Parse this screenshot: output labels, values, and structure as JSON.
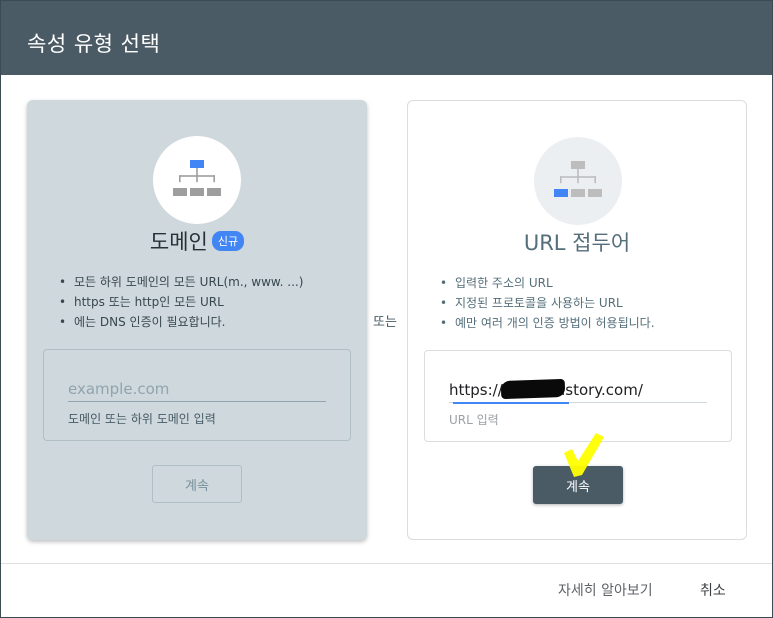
{
  "dialog": {
    "title": "속성 유형 선택"
  },
  "domain_card": {
    "title": "도메인",
    "badge": "신규",
    "bullets": [
      "모든 하위 도메인의 모든 URL(m., www. ...)",
      "https 또는 http인 모든 URL",
      "에는 DNS 인증이 필요합니다."
    ],
    "input": {
      "value": "",
      "placeholder": "example.com",
      "help": "도메인 또는 하위 도메인 입력"
    },
    "continue_label": "계속",
    "icon": "sitemap-icon"
  },
  "separator": {
    "label": "또는"
  },
  "url_card": {
    "title": "URL 접두어",
    "bullets": [
      "입력한 주소의 URL",
      "지정된 프로토콜을 사용하는 URL",
      "예만 여러 개의 인증 방법이 허용됩니다."
    ],
    "input": {
      "value": "https://          .tistory.com/",
      "help": "URL 입력"
    },
    "continue_label": "계속",
    "icon": "sitemap-icon"
  },
  "footer": {
    "learn_more": "자세히 알아보기",
    "cancel": "취소"
  },
  "colors": {
    "header_bg": "#4b5b66",
    "domain_card_bg": "#cfd8dc",
    "accent_blue": "#4285f4",
    "primary_button": "#4b5b66",
    "highlight_yellow": "#ffff00"
  }
}
